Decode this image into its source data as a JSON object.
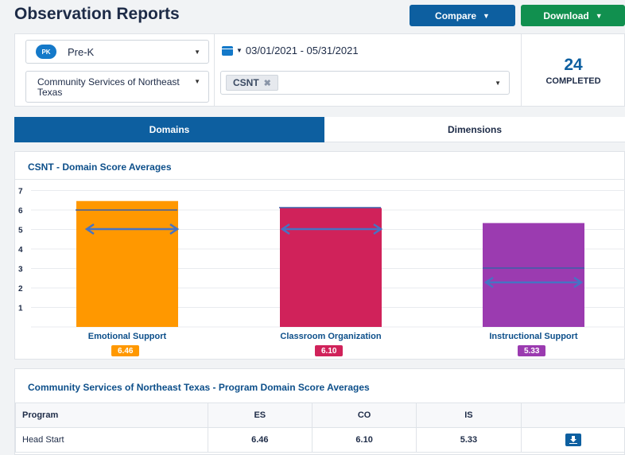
{
  "page": {
    "title": "Observation Reports"
  },
  "toolbar": {
    "compare_label": "Compare",
    "download_label": "Download"
  },
  "filters": {
    "grade_badge": "PK",
    "grade_label": "Pre-K",
    "organization": "Community Services of Northeast Texas",
    "date_range": "03/01/2021 - 05/31/2021",
    "site_tag": "CSNT"
  },
  "summary": {
    "completed_count": "24",
    "completed_label": "COMPLETED"
  },
  "tabs": [
    {
      "label": "Domains",
      "active": true
    },
    {
      "label": "Dimensions",
      "active": false
    }
  ],
  "chart_data": {
    "type": "bar",
    "title": "CSNT - Domain Score Averages",
    "categories": [
      "Emotional Support",
      "Classroom Organization",
      "Instructional Support"
    ],
    "values": [
      6.46,
      6.1,
      5.33
    ],
    "value_labels": [
      "6.46",
      "6.10",
      "5.33"
    ],
    "colors": [
      "#ff9800",
      "#d0225a",
      "#9b3bb0"
    ],
    "ylim": [
      0,
      7
    ],
    "yticks": [
      "1",
      "2",
      "3",
      "4",
      "5",
      "6",
      "7"
    ],
    "grid": true
  },
  "table": {
    "title": "Community Services of Northeast Texas - Program Domain Score Averages",
    "headers": [
      "Program",
      "ES",
      "CO",
      "IS"
    ],
    "rows": [
      [
        "Head Start",
        "6.46",
        "6.10",
        "5.33"
      ]
    ]
  },
  "icons": {
    "download_row": "download-icon",
    "calendar": "calendar-icon",
    "remove_tag": "close-icon"
  }
}
